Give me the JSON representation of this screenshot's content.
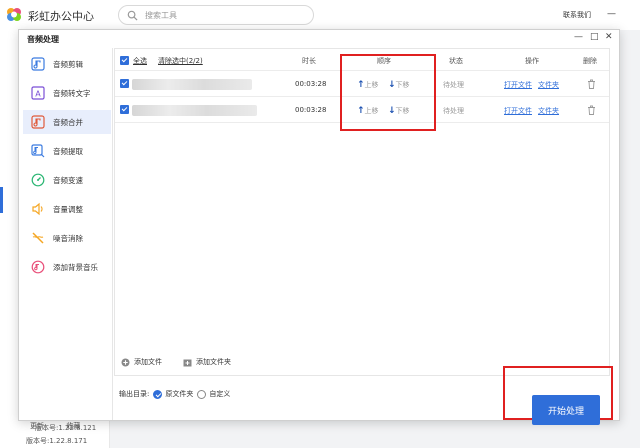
{
  "app": {
    "title": "彩虹办公中心",
    "search_placeholder": "搜索工具",
    "contact": "联系我们",
    "minimize": "—",
    "bottom_links": [
      "更新",
      "收藏"
    ],
    "version": "版本号:1.22.8.171"
  },
  "dialog": {
    "title": "音频处理",
    "controls": [
      "—",
      "□",
      "✕"
    ],
    "version": "版本号:1.22.8.121"
  },
  "sidebar": {
    "items": [
      {
        "label": "音频剪辑",
        "icon": "audio-cut-icon",
        "active": false
      },
      {
        "label": "音频转文字",
        "icon": "audio-to-text-icon",
        "active": false
      },
      {
        "label": "音频合并",
        "icon": "audio-merge-icon",
        "active": true
      },
      {
        "label": "音频提取",
        "icon": "audio-extract-icon",
        "active": false
      },
      {
        "label": "音频变速",
        "icon": "audio-speed-icon",
        "active": false
      },
      {
        "label": "音量调整",
        "icon": "volume-icon",
        "active": false
      },
      {
        "label": "噪音消除",
        "icon": "noise-remove-icon",
        "active": false
      },
      {
        "label": "添加背景音乐",
        "icon": "bg-music-icon",
        "active": false
      }
    ]
  },
  "table": {
    "select_all": "全选",
    "clear_selected": "清除选中(2/2)",
    "headers": {
      "duration": "时长",
      "order": "顺序",
      "status": "状态",
      "actions": "操作",
      "delete": "删除"
    },
    "rows": [
      {
        "duration": "00:03:28",
        "up": "上移",
        "down": "下移",
        "status": "待处理",
        "open": "打开文件",
        "folder": "文件夹"
      },
      {
        "duration": "00:03:28",
        "up": "上移",
        "down": "下移",
        "status": "待处理",
        "open": "打开文件",
        "folder": "文件夹"
      }
    ]
  },
  "footer": {
    "add_file": "添加文件",
    "add_folder": "添加文件夹",
    "output_label": "输出目录:",
    "output_options": [
      "原文件夹",
      "自定义"
    ],
    "start": "开始处理"
  },
  "colors": {
    "accent": "#2f6ed9",
    "highlight": "#e02020"
  }
}
